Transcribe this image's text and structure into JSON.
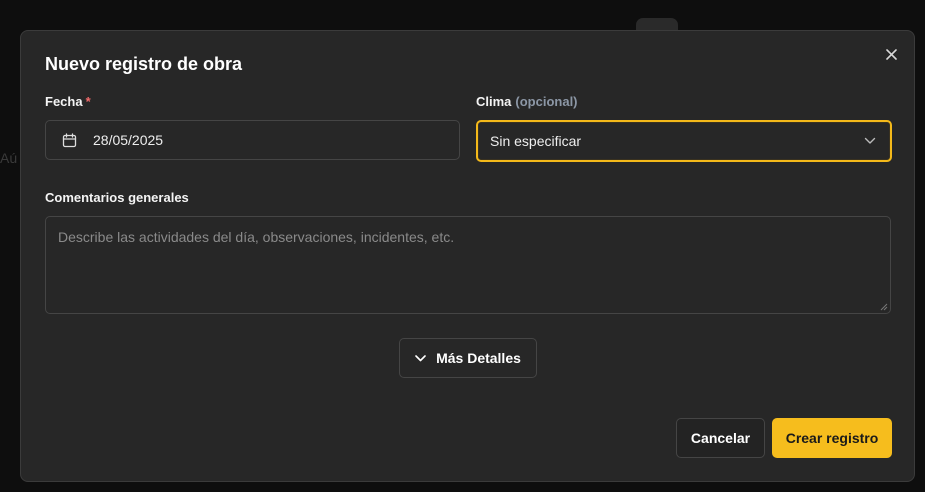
{
  "background": {
    "partial_text": "Aú"
  },
  "dialog": {
    "title": "Nuevo registro de obra",
    "close_icon": "close-icon",
    "date_field": {
      "label": "Fecha",
      "required_mark": "*",
      "value": "28/05/2025",
      "icon": "calendar-icon"
    },
    "weather_field": {
      "label": "Clima",
      "optional_text": "(opcional)",
      "selected_value": "Sin especificar",
      "icon": "chevron-down-icon"
    },
    "comments_field": {
      "label": "Comentarios generales",
      "placeholder": "Describe las actividades del día, observaciones, incidentes, etc."
    },
    "more_details_button": {
      "label": "Más Detalles",
      "icon": "chevron-down-icon"
    },
    "cancel_button": {
      "label": "Cancelar"
    },
    "create_button": {
      "label": "Crear registro"
    }
  },
  "colors": {
    "accent": "#f6bd1d",
    "required": "#f26b6b",
    "dialog_bg": "#272727",
    "page_bg": "#0e0e0e"
  }
}
